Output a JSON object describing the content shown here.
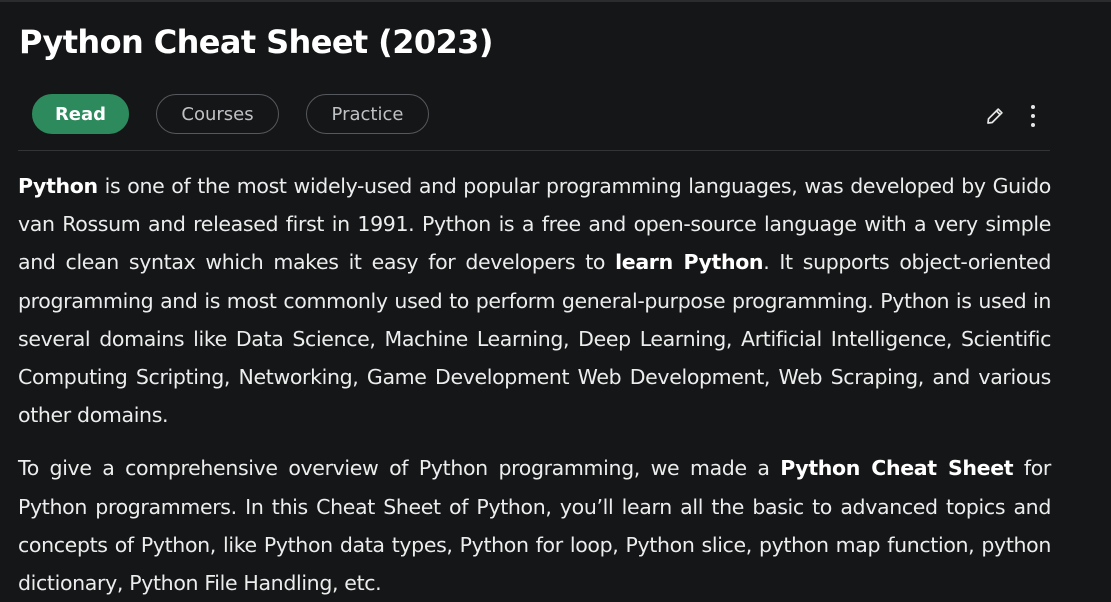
{
  "article": {
    "title": "Python Cheat Sheet (2023)",
    "tabs": [
      {
        "label": "Read",
        "active": true
      },
      {
        "label": "Courses",
        "active": false
      },
      {
        "label": "Practice",
        "active": false
      }
    ],
    "tools": {
      "edit_icon": "pencil-icon",
      "more_icon": "vertical-ellipsis-icon"
    },
    "paragraph1": {
      "bold_intro": "Python",
      "text_1": " is one of the most widely-used and popular programming languages, was developed by Guido van Rossum and released first in 1991. Python is a free and open-source language with a very simple and clean syntax which makes it easy for developers to ",
      "bold_link": "learn Python",
      "text_2": ". It supports object-oriented programming and is most commonly used to perform general-purpose programming. Python is used in several domains like Data Science, Machine Learning, Deep Learning, Artificial Intelligence, Scientific Computing Scripting, Networking, Game Development Web Development, Web Scraping, and various other domains."
    },
    "paragraph2": {
      "text_1": "To give a comprehensive overview of Python programming, we made a ",
      "bold": "Python Cheat Sheet",
      "text_2": " for Python programmers. In this Cheat Sheet of Python, you’ll learn all the basic to advanced topics and concepts of Python, like Python data types, Python for loop, Python slice, python map function, python dictionary, Python File Handling, etc."
    }
  },
  "colors": {
    "background": "#151617",
    "accent_green": "#2d8a5c",
    "text": "#eceded"
  }
}
